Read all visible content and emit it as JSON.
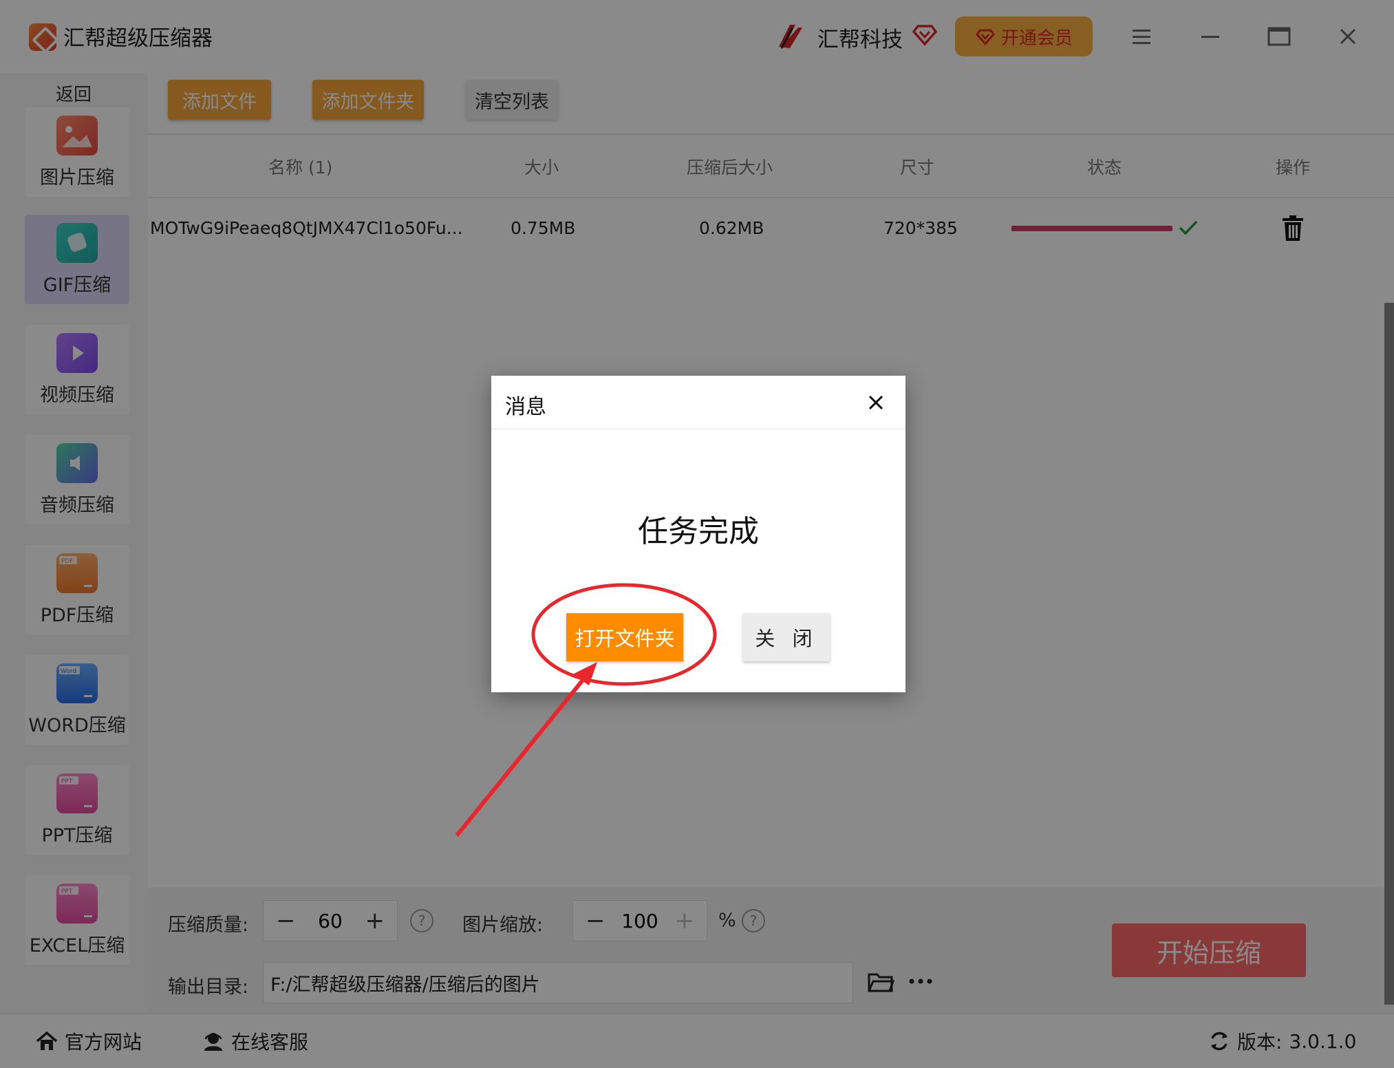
{
  "window": {
    "title": "汇帮超级压缩器",
    "brand": "汇帮科技",
    "vip_label": "开通会员"
  },
  "sidebar": {
    "back_label": "返回",
    "items": [
      {
        "label": "图片压缩",
        "icon": "image-icon"
      },
      {
        "label": "GIF压缩",
        "icon": "gif-icon",
        "active": true
      },
      {
        "label": "视频压缩",
        "icon": "video-icon"
      },
      {
        "label": "音频压缩",
        "icon": "audio-icon"
      },
      {
        "label": "PDF压缩",
        "icon": "pdf-icon",
        "badge": "PDF"
      },
      {
        "label": "WORD压缩",
        "icon": "word-icon",
        "badge": "Word"
      },
      {
        "label": "PPT压缩",
        "icon": "ppt-icon",
        "badge": "PPT"
      },
      {
        "label": "EXCEL压缩",
        "icon": "excel-icon",
        "badge": "PPT"
      }
    ]
  },
  "toolbar": {
    "add_file": "添加文件",
    "add_folder": "添加文件夹",
    "clear_list": "清空列表"
  },
  "table": {
    "headers": [
      "名称 (1)",
      "大小",
      "压缩后大小",
      "尺寸",
      "状态",
      "操作"
    ],
    "rows": [
      {
        "name": "MOTwG9iPeaeq8QtJMX47Cl1o50Fu...",
        "size": "0.75MB",
        "compressed": "0.62MB",
        "dimensions": "720*385",
        "progress": 1.0,
        "done": true
      }
    ]
  },
  "settings": {
    "quality_label": "压缩质量:",
    "quality_value": "60",
    "scale_label": "图片缩放:",
    "scale_value": "100",
    "scale_unit": "%",
    "output_label": "输出目录:",
    "output_path": "F:/汇帮超级压缩器/压缩后的图片",
    "start_label": "开始压缩"
  },
  "statusbar": {
    "website": "官方网站",
    "support": "在线客服",
    "version_label": "版本:",
    "version": "3.0.1.0"
  },
  "dialog": {
    "title": "消息",
    "message": "任务完成",
    "open_folder": "打开文件夹",
    "close": "关 闭"
  },
  "colors": {
    "accent_orange": "#f7a43a",
    "dialog_button": "#ff8c00",
    "start_button": "#ff6a6a",
    "progress": "#d33a6a",
    "annotation_red": "#e8262c"
  }
}
